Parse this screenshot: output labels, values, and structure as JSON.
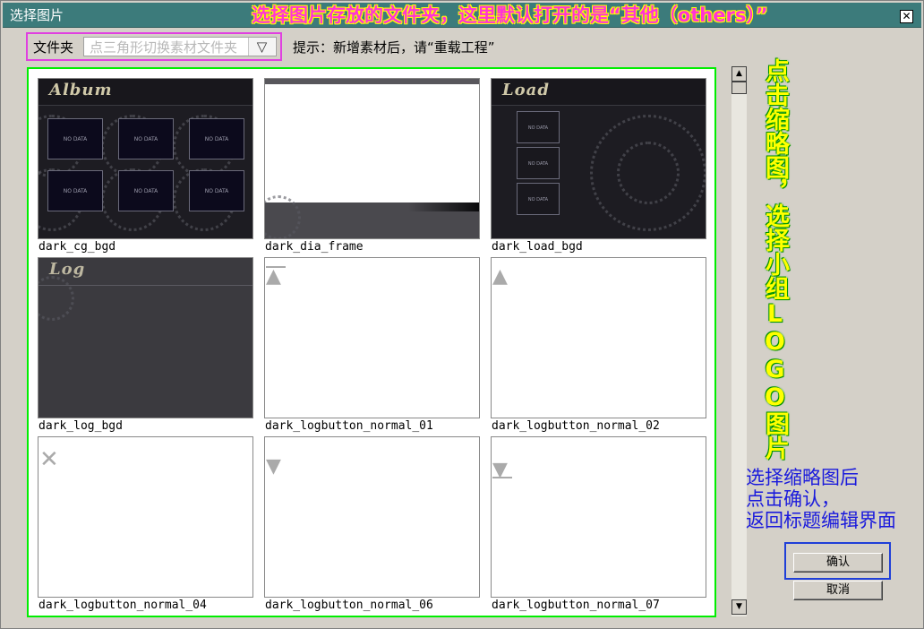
{
  "window": {
    "title": "选择图片",
    "close_glyph": "✕",
    "annotation_top": "选择图片存放的文件夹，这里默认打开的是“其他（others）”"
  },
  "folder": {
    "label": "文件夹",
    "placeholder": "点三角形切换素材文件夹",
    "dropdown_glyph": "▽"
  },
  "hint": "提示：新增素材后，请“重载工程”",
  "annotations": {
    "vertical": "点击缩略图，选择小组LOGO图片",
    "blue_lines": [
      "选择缩略图后",
      "点击确认，",
      "返回标题编辑界面"
    ]
  },
  "buttons": {
    "confirm": "确认",
    "cancel": "取消"
  },
  "scroll": {
    "up_glyph": "▲",
    "down_glyph": "▼"
  },
  "thumb_text": {
    "album_title": "Album",
    "load_title": "Load",
    "log_title": "Log",
    "no_data": "NO DATA"
  },
  "thumbnails": [
    {
      "caption": "dark_cg_bgd",
      "icon": "album-thumbnail"
    },
    {
      "caption": "dark_dia_frame",
      "icon": "dialog-frame-thumbnail"
    },
    {
      "caption": "dark_load_bgd",
      "icon": "load-thumbnail"
    },
    {
      "caption": "dark_log_bgd",
      "icon": "log-thumbnail"
    },
    {
      "caption": "dark_logbutton_normal_01",
      "icon": "triangle-up-bar-icon",
      "glyph": "⏶"
    },
    {
      "caption": "dark_logbutton_normal_02",
      "icon": "triangle-up-icon",
      "glyph": "▲"
    },
    {
      "caption": "dark_logbutton_normal_04",
      "icon": "x-icon",
      "glyph": "✕"
    },
    {
      "caption": "dark_logbutton_normal_06",
      "icon": "triangle-down-icon",
      "glyph": "▼"
    },
    {
      "caption": "dark_logbutton_normal_07",
      "icon": "triangle-down-bar-icon",
      "glyph": "▼"
    }
  ],
  "colors": {
    "titlebar": "#3c7b7b",
    "annotation_pink": "#ff33d6",
    "annotation_yellow": "#ffff00",
    "annotation_blue": "#1a1adc",
    "gallery_border": "#00ee00",
    "folder_border": "#e040e0",
    "confirm_frame": "#1f3fd8"
  }
}
